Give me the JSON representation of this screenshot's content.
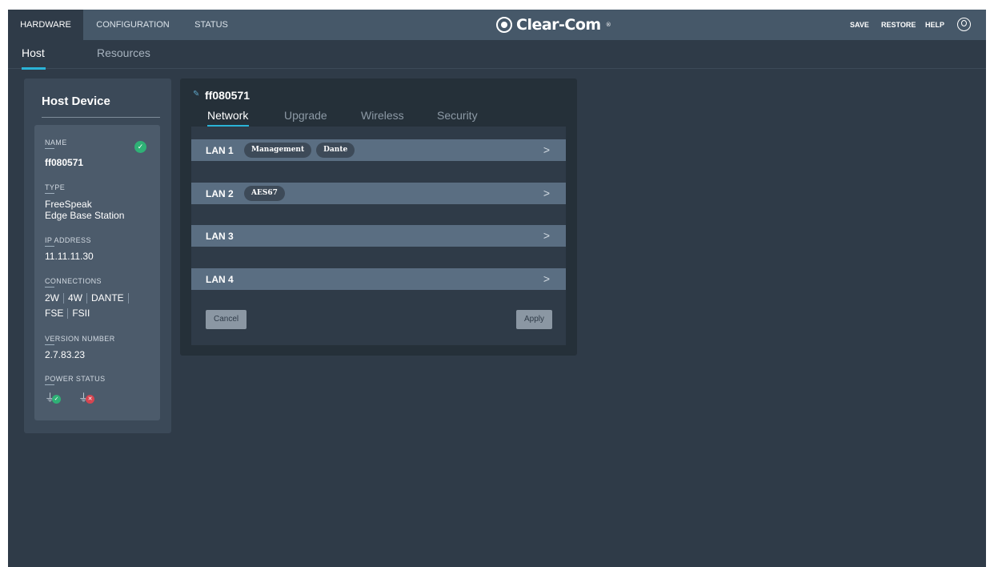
{
  "topbar": {
    "tabs": [
      "HARDWARE",
      "CONFIGURATION",
      "STATUS"
    ],
    "logo_text": "Clear-Com",
    "logo_mark": "®",
    "links": [
      "SAVE",
      "RESTORE",
      "HELP"
    ]
  },
  "subnav": {
    "tabs": [
      "Host",
      "Resources"
    ]
  },
  "host": {
    "title": "Host Device",
    "name_label": "NAME",
    "name_value": "ff080571",
    "type_label": "TYPE",
    "type_line1": "FreeSpeak",
    "type_line2": "Edge Base Station",
    "ip_label": "IP ADDRESS",
    "ip_value": "11.11.11.30",
    "connections_label": "CONNECTIONS",
    "connections_row1": [
      "2W",
      "4W",
      "DANTE"
    ],
    "connections_row2": [
      "FSE",
      "FSII"
    ],
    "version_label": "VERSION NUMBER",
    "version_value": "2.7.83.23",
    "power_label": "POWER STATUS",
    "power": [
      "ok",
      "fault"
    ]
  },
  "network": {
    "device_name": "ff080571",
    "tabs": [
      "Network",
      "Upgrade",
      "Wireless",
      "Security"
    ],
    "lans": [
      {
        "label": "LAN 1",
        "tags": [
          "Management",
          "Dante"
        ]
      },
      {
        "label": "LAN 2",
        "tags": [
          "AES67"
        ]
      },
      {
        "label": "LAN 3",
        "tags": []
      },
      {
        "label": "LAN 4",
        "tags": []
      }
    ],
    "cancel_label": "Cancel",
    "apply_label": "Apply"
  },
  "colors": {
    "accent": "#2ab3d7",
    "ok": "#2fb176",
    "error": "#d64550",
    "topbar": "#465869",
    "background": "#2f3b48"
  }
}
